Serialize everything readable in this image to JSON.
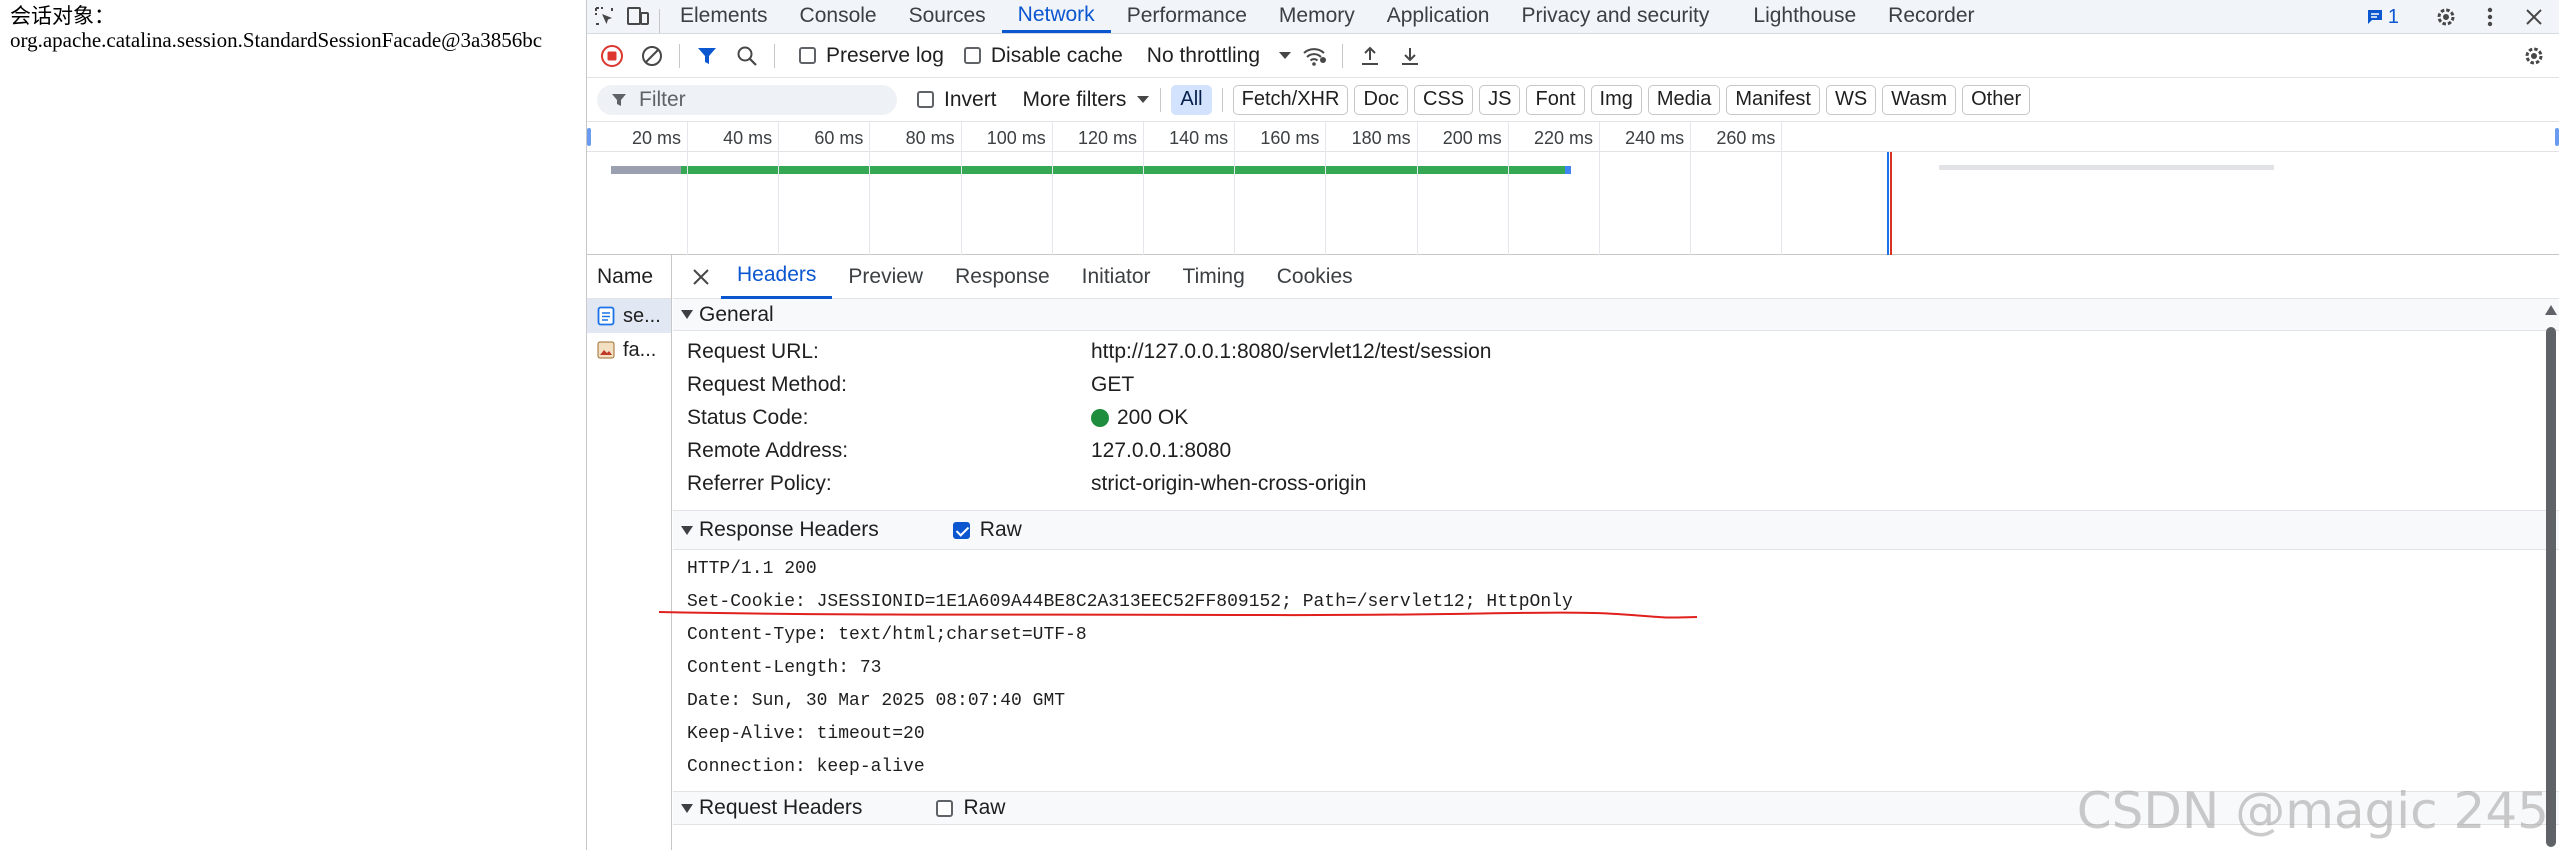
{
  "page": {
    "line1": "会话对象：",
    "line2": "org.apache.catalina.session.StandardSessionFacade@3a3856bc"
  },
  "devtools": {
    "tabs": [
      "Elements",
      "Console",
      "Sources",
      "Network",
      "Performance",
      "Memory",
      "Application",
      "Privacy and security",
      "Lighthouse",
      "Recorder"
    ],
    "active_tab": "Network",
    "issues_count": "1",
    "toolbar": {
      "preserve_log": "Preserve log",
      "disable_cache": "Disable cache",
      "throttling": "No throttling"
    },
    "filter": {
      "placeholder": "Filter",
      "invert": "Invert",
      "more_filters": "More filters",
      "chips": [
        "All",
        "Fetch/XHR",
        "Doc",
        "CSS",
        "JS",
        "Font",
        "Img",
        "Media",
        "Manifest",
        "WS",
        "Wasm",
        "Other"
      ],
      "active_chip": "All"
    },
    "overview": {
      "ticks": [
        "20 ms",
        "40 ms",
        "60 ms",
        "80 ms",
        "100 ms",
        "120 ms",
        "140 ms",
        "160 ms",
        "180 ms",
        "200 ms",
        "220 ms",
        "240 ms",
        "260 ms"
      ]
    },
    "requests": {
      "header": "Name",
      "rows": [
        {
          "name": "se...",
          "icon": "document-icon",
          "selected": true
        },
        {
          "name": "fa...",
          "icon": "image-icon",
          "selected": false
        }
      ]
    },
    "detail": {
      "tabs": [
        "Headers",
        "Preview",
        "Response",
        "Initiator",
        "Timing",
        "Cookies"
      ],
      "active_tab": "Headers",
      "general": {
        "title": "General",
        "rows": [
          {
            "key": "Request URL:",
            "value": "http://127.0.0.1:8080/servlet12/test/session"
          },
          {
            "key": "Request Method:",
            "value": "GET"
          },
          {
            "key": "Status Code:",
            "value": "200 OK"
          },
          {
            "key": "Remote Address:",
            "value": "127.0.0.1:8080"
          },
          {
            "key": "Referrer Policy:",
            "value": "strict-origin-when-cross-origin"
          }
        ]
      },
      "response_headers": {
        "title": "Response Headers",
        "raw_label": "Raw",
        "lines": [
          "HTTP/1.1 200",
          "Set-Cookie: JSESSIONID=1E1A609A44BE8C2A313EEC52FF809152; Path=/servlet12; HttpOnly",
          "Content-Type: text/html;charset=UTF-8",
          "Content-Length: 73",
          "Date: Sun, 30 Mar 2025 08:07:40 GMT",
          "Keep-Alive: timeout=20",
          "Connection: keep-alive"
        ]
      },
      "request_headers": {
        "title": "Request Headers",
        "raw_label": "Raw"
      }
    }
  },
  "watermark": "CSDN @magic 245",
  "colors": {
    "accent": "#0b57d0",
    "status_ok": "#1e8e3e",
    "annotation": "#e0201c"
  }
}
